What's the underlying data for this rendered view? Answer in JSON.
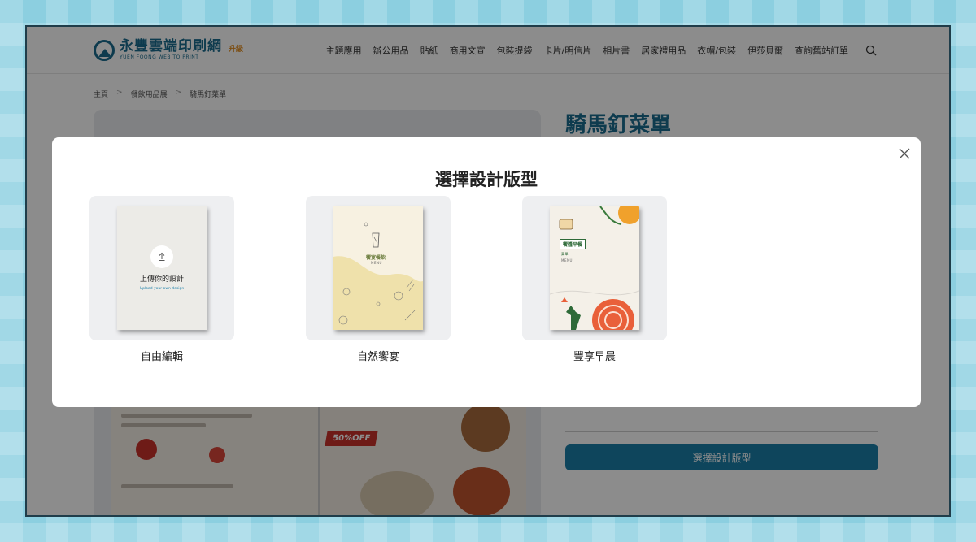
{
  "site": {
    "logo": {
      "name_cn": "永豐雲端印刷網",
      "name_en": "YUEN FOONG WEB TO PRINT",
      "badge": "升級"
    },
    "nav": [
      "主題應用",
      "辦公用品",
      "貼紙",
      "商用文宣",
      "包裝提袋",
      "卡片/明信片",
      "相片書",
      "居家禮用品",
      "衣帽/包裝",
      "伊莎貝爾",
      "查詢舊站訂單"
    ],
    "breadcrumb": [
      "主頁",
      "餐飲用品展",
      "騎馬釘菜單"
    ],
    "product_title": "騎馬釘菜單",
    "cta_label": "選擇設計版型",
    "menu_offer": "50%OFF"
  },
  "modal": {
    "title": "選擇設計版型",
    "templates": [
      {
        "label": "自由編輯",
        "upload_cn": "上傳你的設計",
        "upload_en": "Upload your own design"
      },
      {
        "label": "自然饗宴",
        "brand": "饗宴餐飲",
        "menu": "MENU"
      },
      {
        "label": "豐享早晨",
        "brand": "饗醬早餐",
        "sub": "菜單",
        "menu": "MENU"
      }
    ]
  },
  "colors": {
    "brand": "#1a6c8e",
    "accent": "#e08a1c",
    "cta": "#1a7ea8"
  }
}
